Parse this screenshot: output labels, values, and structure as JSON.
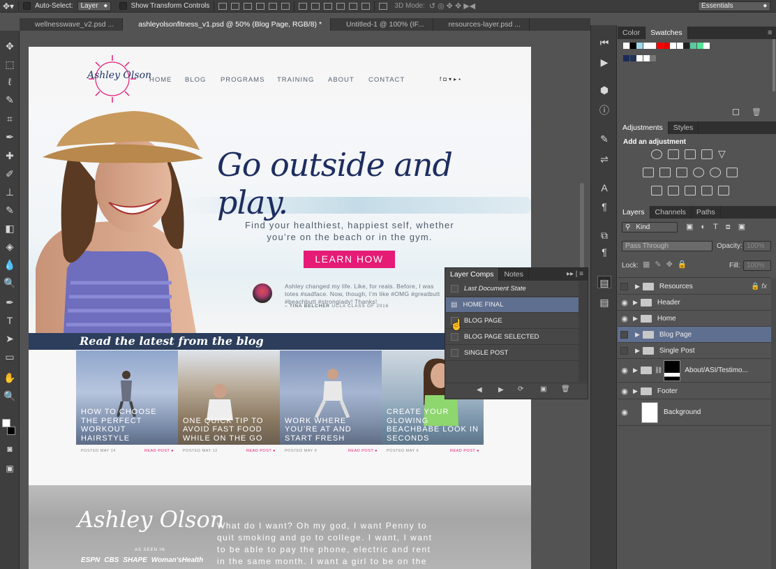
{
  "app": {
    "zoom_note": "50%"
  },
  "options_bar": {
    "auto_select_label": "Auto-Select:",
    "auto_select_value": "Layer",
    "show_transform_label": "Show Transform Controls",
    "mode_3d_label": "3D Mode:",
    "workspace": "Essentials"
  },
  "doc_tabs": [
    {
      "label": "wellnesswave_v2.psd ...",
      "active": false
    },
    {
      "label": "ashleyolsonfitness_v1.psd @ 50% (Blog Page, RGB/8) *",
      "active": true
    },
    {
      "label": "Untitled-1 @ 100% (IF...",
      "active": false
    },
    {
      "label": "resources-layer.psd ...",
      "active": false
    }
  ],
  "color_panel": {
    "tabs": [
      "Color",
      "Swatches"
    ],
    "active": "Swatches",
    "swatches_row1": [
      "#ffffff",
      "#000000",
      "#9fd9ea",
      "#ffffff",
      "#ffffff",
      "#ff0000",
      "#e60000",
      "#ffffff",
      "#ffffff",
      "#222222",
      "#5ac8a0",
      "#55e39a",
      "#ffffff"
    ],
    "swatches_row2": [
      "#1a2a5a",
      "#223355",
      "#ffffff",
      "#ffffff",
      "#777777"
    ]
  },
  "adjustments_panel": {
    "tabs": [
      "Adjustments",
      "Styles"
    ],
    "active": "Adjustments",
    "heading": "Add an adjustment"
  },
  "layers_panel": {
    "tabs": [
      "Layers",
      "Channels",
      "Paths"
    ],
    "active": "Layers",
    "kind_filter": "Kind",
    "blend_mode": "Pass Through",
    "opacity_label": "Opacity:",
    "opacity_value": "100%",
    "lock_label": "Lock:",
    "fill_label": "Fill:",
    "fill_value": "100%",
    "layers": [
      {
        "name": "Resources",
        "visible": false,
        "type": "folder",
        "locked": true,
        "fx": true,
        "selected": false
      },
      {
        "name": "Header",
        "visible": true,
        "type": "folder",
        "selected": false
      },
      {
        "name": "Home",
        "visible": true,
        "type": "folder",
        "selected": false
      },
      {
        "name": "Blog Page",
        "visible": false,
        "type": "folder",
        "selected": true
      },
      {
        "name": "Single Post",
        "visible": false,
        "type": "folder",
        "selected": false
      },
      {
        "name": "About/ASI/Testimo...",
        "visible": true,
        "type": "folder-mask",
        "selected": false
      },
      {
        "name": "Footer",
        "visible": true,
        "type": "folder",
        "selected": false
      },
      {
        "name": "Background",
        "visible": true,
        "type": "image",
        "selected": false
      }
    ]
  },
  "layer_comps_panel": {
    "tabs": [
      "Layer Comps",
      "Notes"
    ],
    "active": "Layer Comps",
    "comps": [
      {
        "name": "Last Document State",
        "italic": true,
        "selected": false
      },
      {
        "name": "HOME FINAL",
        "italic": false,
        "selected": true
      },
      {
        "name": "BLOG PAGE",
        "italic": false,
        "selected": false
      },
      {
        "name": "BLOG PAGE SELECTED",
        "italic": false,
        "selected": false
      },
      {
        "name": "SINGLE POST",
        "italic": false,
        "selected": false
      }
    ]
  },
  "site": {
    "logo_text": "Ashley Olson",
    "nav": [
      "HOME",
      "BLOG",
      "PROGRAMS",
      "TRAINING",
      "ABOUT",
      "CONTACT"
    ],
    "social_icons": [
      "f",
      "ig",
      "t",
      "yt",
      "in"
    ],
    "hero_headline": "Go outside and play.",
    "hero_sub_1": "Find your healthiest, happiest self, whether",
    "hero_sub_2": "you’re on the beach or in the gym.",
    "cta": "LEARN HOW",
    "testimonial": "Ashley changed my life. Like, for reals. Before, I was totes #sadface. Now, though, I’m like #OMG #greatbutt #beachbutt #strongiady! Thanks!",
    "testimonial_author": "– TINA BELCHER",
    "testimonial_role": "UCLA CLASS OF 2016",
    "blog_heading": "Read the latest from the blog",
    "posts": [
      {
        "title": "HOW TO CHOOSE THE PERFECT WORKOUT HAIRSTYLE",
        "date": "POSTED MAY 14",
        "link": "READ POST ●"
      },
      {
        "title": "ONE QUICK TIP TO AVOID FAST FOOD WHILE ON THE GO",
        "date": "POSTED MAY 12",
        "link": "READ POST ●"
      },
      {
        "title": "WORK WHERE YOU’RE AT AND START FRESH",
        "date": "POSTED MAY 9",
        "link": "READ POST ●"
      },
      {
        "title": "CREATE YOUR GLOWING BEACHBABE LOOK IN SECONDS",
        "date": "POSTED MAY 6",
        "link": "READ POST ●"
      }
    ],
    "footer_logo": "Ashley Olson",
    "as_seen_in": "AS SEEN IN",
    "press": [
      "ESPN",
      "CBS",
      "SHAPE",
      "Woman'sHealth"
    ],
    "footer_text": "What do I want? Oh my god, I want Penny to quit smoking and go to college. I want, I want to be able to pay the phone, electric and rent in the same month. I want a girl to be on the cover of"
  }
}
